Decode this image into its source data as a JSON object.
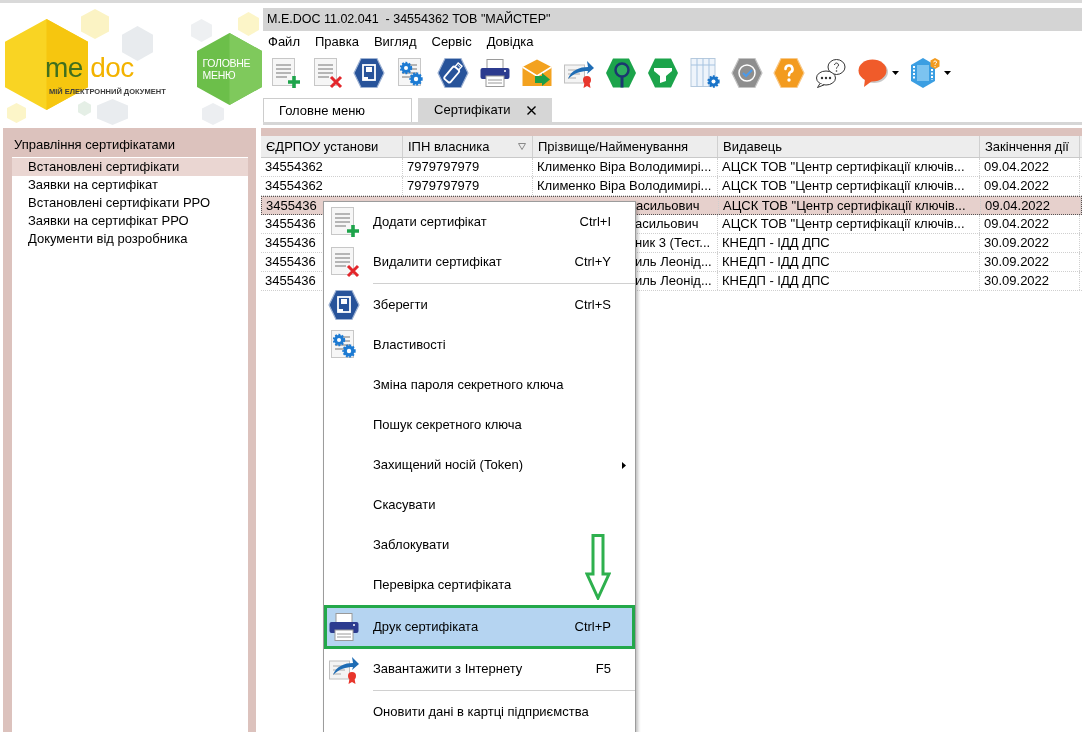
{
  "logo": {
    "wordmark": [
      "me",
      "doc"
    ],
    "tagline": "МІЙ ЕЛЕКТРОННИЙ ДОКУМЕНТ"
  },
  "main_menu_button": {
    "label": "ГОЛОВНЕ МЕНЮ"
  },
  "window": {
    "title": "M.E.DOC 11.02.041  - 34554362 ТОВ \"МАЙСТЕР\""
  },
  "menu_bar": [
    "Файл",
    "Правка",
    "Вигляд",
    "Сервіс",
    "Довідка"
  ],
  "tabs": [
    {
      "label": "Головне меню",
      "selected": false,
      "closable": false
    },
    {
      "label": "Сертифікати",
      "selected": true,
      "closable": true
    }
  ],
  "sidebar": {
    "title": "Управління сертифікатами",
    "items": [
      {
        "label": "Встановлені сертифікати",
        "selected": true
      },
      {
        "label": "Заявки на сертифікат",
        "selected": false
      },
      {
        "label": "Встановлені сертифікати РРО",
        "selected": false
      },
      {
        "label": "Заявки на сертифікат РРО",
        "selected": false
      },
      {
        "label": "Документи від розробника",
        "selected": false
      }
    ]
  },
  "table": {
    "columns": [
      {
        "label": "ЄДРПОУ установи",
        "filter": false
      },
      {
        "label": "ІПН власника",
        "filter": true
      },
      {
        "label": "Прізвище/Найменування",
        "filter": false
      },
      {
        "label": "Видавець",
        "filter": false
      },
      {
        "label": "Закінчення дії",
        "filter": false
      }
    ],
    "rows": [
      {
        "edrpou": "34554362",
        "ipn": "7979797979",
        "name": "Клименко Віра Володимирі...",
        "issuer": "АЦСК ТОВ \"Центр сертифікації ключів...",
        "expires": "09.04.2022",
        "selected": false
      },
      {
        "edrpou": "34554362",
        "ipn": "7979797979",
        "name": "Клименко Віра Володимирі...",
        "issuer": "АЦСК ТОВ \"Центр сертифікації ключів...",
        "expires": "09.04.2022",
        "selected": false
      },
      {
        "edrpou": "3455436",
        "name": "асильович",
        "issuer": "АЦСК ТОВ \"Центр сертифікації ключів...",
        "expires": "09.04.2022",
        "selected": true
      },
      {
        "edrpou": "3455436",
        "name": "асильович",
        "issuer": "АЦСК ТОВ \"Центр сертифікації ключів...",
        "expires": "09.04.2022",
        "selected": false
      },
      {
        "edrpou": "3455436",
        "name": "ник 3 (Тест...",
        "issuer": "КНЕДП - ІДД ДПС",
        "expires": "30.09.2022",
        "selected": false
      },
      {
        "edrpou": "3455436",
        "name": "иль Леонід...",
        "issuer": "КНЕДП - ІДД ДПС",
        "expires": "30.09.2022",
        "selected": false
      },
      {
        "edrpou": "3455436",
        "name": "иль Леонід...",
        "issuer": "КНЕДП - ІДД ДПС",
        "expires": "30.09.2022",
        "selected": false
      }
    ]
  },
  "context_menu": {
    "items": [
      {
        "kind": "command",
        "label": "Додати сертифікат",
        "shortcut": "Ctrl+I",
        "selected": false
      },
      {
        "kind": "command",
        "label": "Видалити сертифікат",
        "shortcut": "Ctrl+Y",
        "selected": false
      },
      {
        "kind": "separator"
      },
      {
        "kind": "command",
        "label": "Зберегти",
        "shortcut": "Ctrl+S",
        "selected": false
      },
      {
        "kind": "command",
        "label": "Властивості",
        "selected": false
      },
      {
        "kind": "command",
        "label": "Зміна пароля секретного ключа",
        "selected": false
      },
      {
        "kind": "command",
        "label": "Пошук секретного ключа",
        "selected": false
      },
      {
        "kind": "submenu",
        "label": "Захищений носій (Token)",
        "selected": false
      },
      {
        "kind": "command",
        "label": "Скасувати",
        "selected": false
      },
      {
        "kind": "command",
        "label": "Заблокувати",
        "selected": false
      },
      {
        "kind": "command",
        "label": "Перевірка сертифіката",
        "selected": false
      },
      {
        "kind": "command",
        "label": "Друк сертифіката",
        "shortcut": "Ctrl+P",
        "selected": true
      },
      {
        "kind": "command",
        "label": "Завантажити з Інтернету",
        "shortcut": "F5",
        "selected": false
      },
      {
        "kind": "separator"
      },
      {
        "kind": "command",
        "label": "Оновити дані в картці підприємства",
        "selected": false
      }
    ]
  }
}
